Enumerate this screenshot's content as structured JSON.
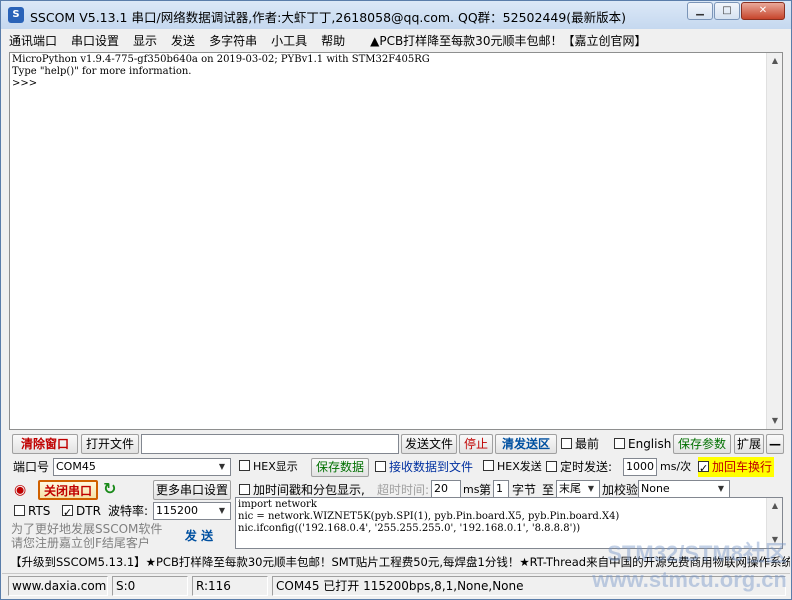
{
  "window": {
    "title": "SSCOM V5.13.1 串口/网络数据调试器,作者:大虾丁丁,2618058@qq.com. QQ群：52502449(最新版本)",
    "icon": "S"
  },
  "menu": {
    "items": [
      "通讯端口",
      "串口设置",
      "显示",
      "发送",
      "多字符串",
      "小工具",
      "帮助"
    ],
    "promo": "▲PCB打样降至每款30元顺丰包邮！【嘉立创官网】"
  },
  "terminal": {
    "lines": "MicroPython v1.9.4-775-gf350b640a on 2019-03-02; PYBv1.1 with STM32F405RG\nType \"help()\" for more information.\n>>>"
  },
  "toolbar": {
    "clear_window": "清除窗口",
    "open_file": "打开文件",
    "file_path": "",
    "send_file": "发送文件",
    "stop": "停止",
    "clear_send": "清发送区",
    "last": "最前",
    "english": "English",
    "save_params": "保存参数",
    "expand": "扩展",
    "collapse": "—"
  },
  "port": {
    "port_label": "端口号",
    "port_value": "COM45",
    "hex_display": "HEX显示",
    "save_data": "保存数据",
    "receive_to_file": "接收数据到文件",
    "hex_send": "HEX发送",
    "timed_send": "定时发送:",
    "interval": "1000",
    "interval_unit": "ms/次",
    "add_crlf": "加回车换行",
    "close_port": "关闭串口",
    "more_settings": "更多串口设置",
    "timestamp": "加时间戳和分包显示,",
    "timeout_label": "超时时间:",
    "timeout_value": "20",
    "timeout_unit": "ms",
    "byte_prefix": "第",
    "byte_index": "1",
    "byte_label": "字节",
    "to_label": "至",
    "to_value": "末尾",
    "checksum_label": "加校验",
    "checksum_value": "None",
    "rts": "RTS",
    "dtr": "DTR",
    "baud_label": "波特率:",
    "baud_value": "115200",
    "notice": "为了更好地发展SSCOM软件\n请您注册嘉立创F结尾客户",
    "send": "发  送"
  },
  "send_area": {
    "text": "import network\nnic = network.WIZNET5K(pyb.SPI(1), pyb.Pin.board.X5, pyb.Pin.board.X4)\nnic.ifconfig(('192.168.0.4', '255.255.255.0', '192.168.0.1', '8.8.8.8'))"
  },
  "promo_bar": "【升级到SSCOM5.13.1】★PCB打样降至每款30元顺丰包邮！SMT贴片工程费50元,每焊盘1分钱！★RT-Thread来自中国的开源免费商用物联网操作系统",
  "status": {
    "site": "www.daxia.com",
    "sent": "S:0",
    "received": "R:116",
    "port_status": "COM45 已打开  115200bps,8,1,None,None"
  },
  "watermark": {
    "line1": "STM32/STM8社区",
    "line2": "www.stmcu.org.cn"
  }
}
